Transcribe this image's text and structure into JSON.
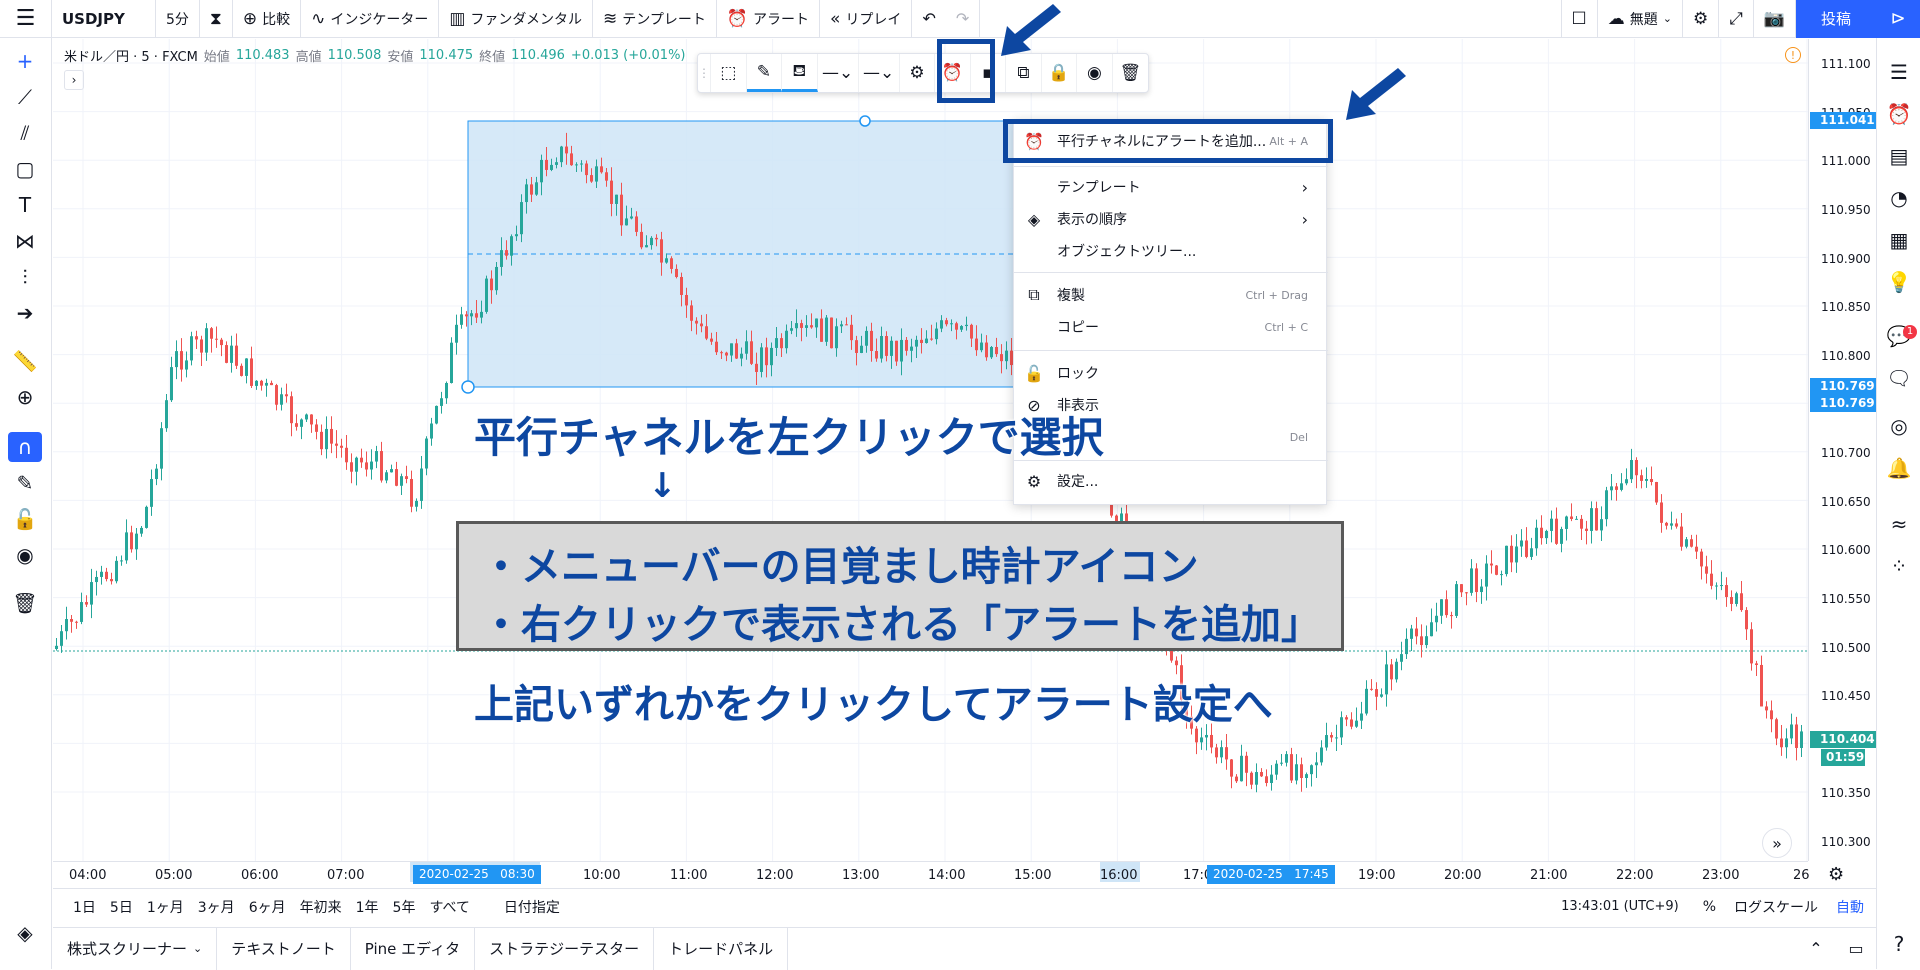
{
  "topbar": {
    "symbol": "USDJPY",
    "interval": "5分",
    "compare": "比較",
    "indicators": "インジケーター",
    "fundamentals": "ファンダメンタル",
    "templates": "テンプレート",
    "alert": "アラート",
    "replay": "リプレイ",
    "layout_name": "無題",
    "publish": "投稿"
  },
  "legend": {
    "name": "米ドル／円 · 5 · FXCM",
    "open_label": "始値",
    "open": "110.483",
    "high_label": "高値",
    "high": "110.508",
    "low_label": "安値",
    "low": "110.475",
    "close_label": "終値",
    "close": "110.496",
    "change": "+0.013 (+0.01%)"
  },
  "price_axis": {
    "ticks": [
      "111.100",
      "111.050",
      "111.000",
      "110.950",
      "110.900",
      "110.850",
      "110.800",
      "110.700",
      "110.650",
      "110.600",
      "110.550",
      "110.500",
      "110.450",
      "110.350",
      "110.300"
    ],
    "channel_top": "111.041",
    "channel_bottom_1": "110.769",
    "channel_bottom_2": "110.769",
    "last_price": "110.404",
    "countdown": "01:59"
  },
  "time_axis": {
    "ticks": [
      "04:00",
      "05:00",
      "06:00",
      "07:00",
      "10:00",
      "11:00",
      "12:00",
      "13:00",
      "14:00",
      "15:00",
      "16:00",
      "17:0",
      "19:00",
      "20:00",
      "21:00",
      "22:00",
      "23:00",
      "26"
    ],
    "selection_start": "2020-02-25   08:30",
    "selection_end": "2020-02-25   17:45"
  },
  "range_bar": {
    "ranges": [
      "1日",
      "5日",
      "1ヶ月",
      "3ヶ月",
      "6ヶ月",
      "年初来",
      "1年",
      "5年",
      "すべて"
    ],
    "goto_date": "日付指定",
    "clock": "13:43:01 (UTC+9)",
    "percent": "%",
    "log_scale": "ログスケール",
    "auto": "自動"
  },
  "bottom_tabs": [
    "株式スクリーナー",
    "テキストノート",
    "Pine エディタ",
    "ストラテジーテスター",
    "トレードパネル"
  ],
  "context_menu": {
    "add_alert": "平行チャネルにアラートを追加...",
    "add_alert_shortcut": "Alt + A",
    "template": "テンプレート",
    "visual_order": "表示の順序",
    "object_tree": "オブジェクトツリー...",
    "clone": "複製",
    "clone_shortcut": "Ctrl + Drag",
    "copy": "コピー",
    "copy_shortcut": "Ctrl + C",
    "lock": "ロック",
    "hide": "非表示",
    "delete_shortcut": "Del",
    "settings": "設定..."
  },
  "annotations": {
    "headline": "平行チャネルを左クリックで選択",
    "down_arrow": "↓",
    "bullet1": "・メニューバーの目覚まし時計アイコン",
    "bullet2": "・右クリックで表示される「アラートを追加」",
    "footer": "上記いずれかをクリックしてアラート設定へ"
  },
  "right_toolbar": {
    "notification_count": "1"
  },
  "colors": {
    "up": "#26a69a",
    "down": "#ef5350",
    "accent": "#2962ff",
    "annotation": "#0d47a1",
    "channel_fill": "#cfe5f7",
    "channel_line": "#2196f3"
  }
}
